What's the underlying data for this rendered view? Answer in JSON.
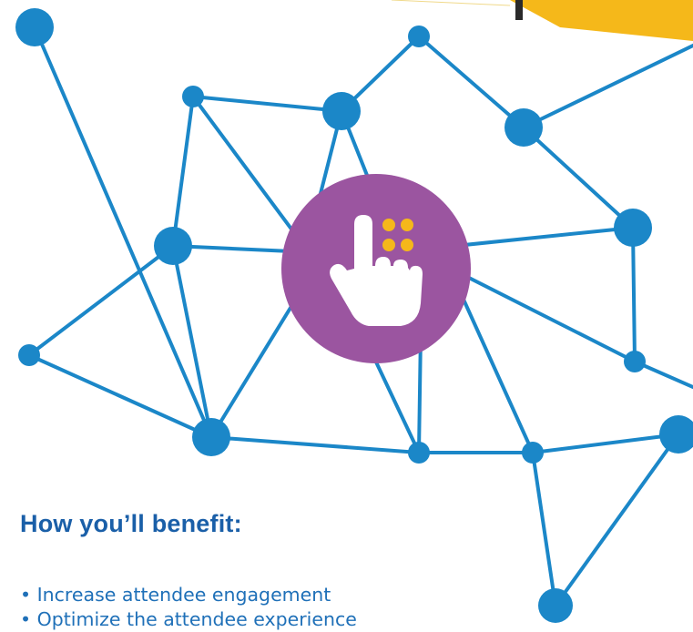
{
  "graphic": {
    "accent_blue": "#1b87c8",
    "accent_purple": "#9b55a0",
    "accent_yellow": "#f5b81a",
    "central_icon": "tap-gesture-icon"
  },
  "section": {
    "heading": "How you’ll benefit:",
    "heading_color": "#1a5fa8",
    "text_color": "#1f70b8",
    "benefits": [
      "• Increase attendee engagement",
      "• Optimize the attendee experience"
    ]
  }
}
